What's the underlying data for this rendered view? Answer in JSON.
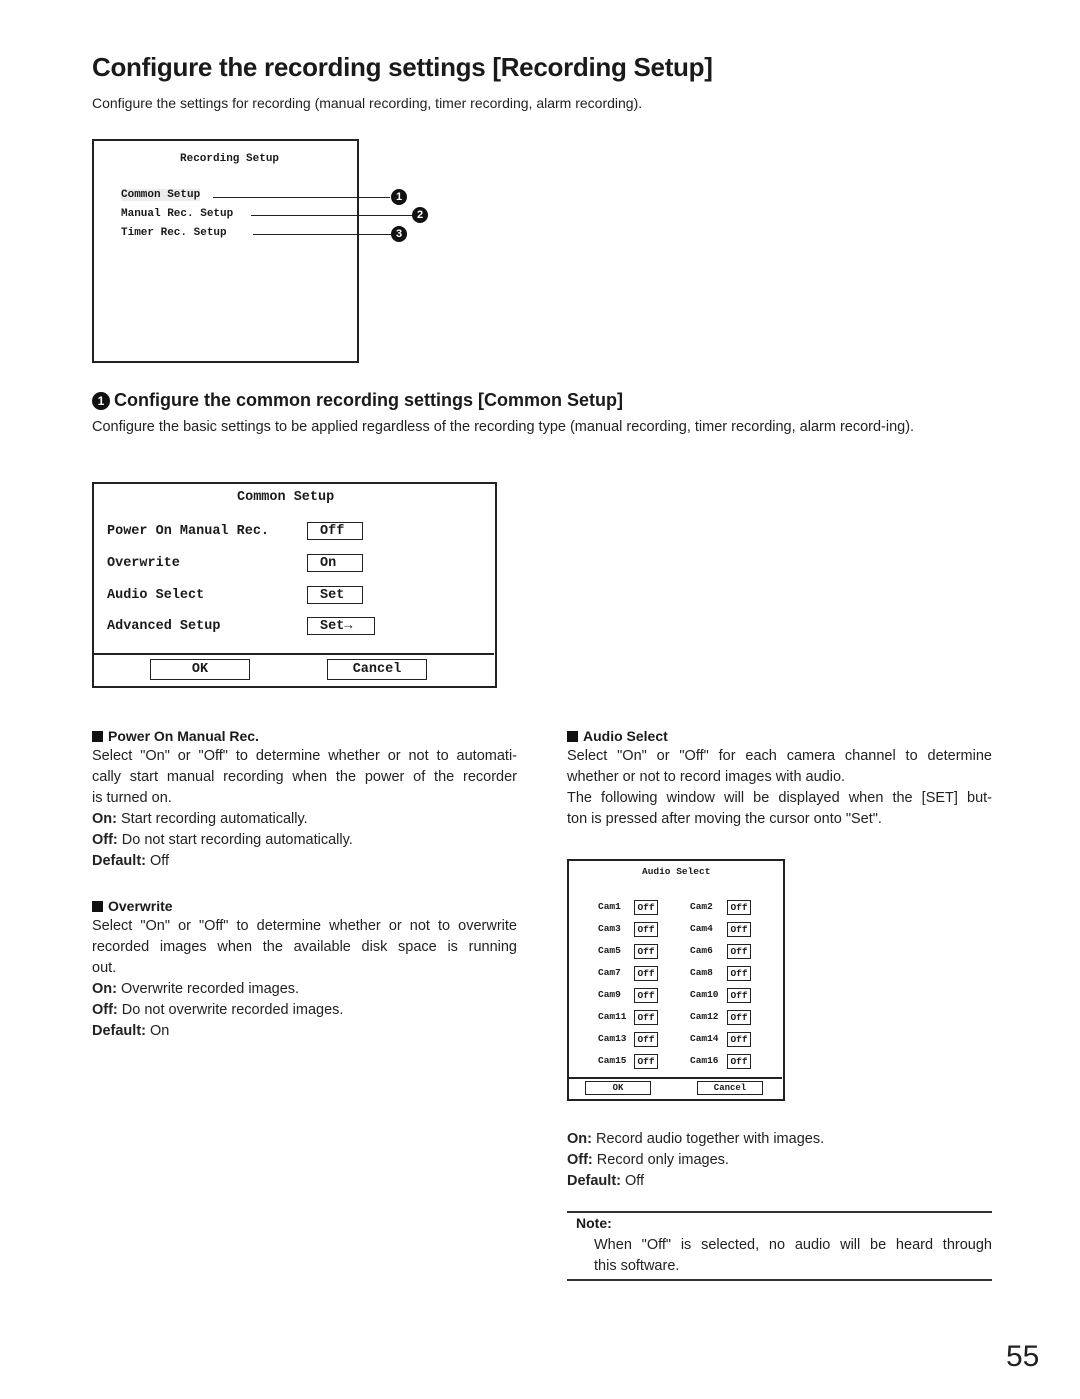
{
  "page": {
    "title": "Configure the recording settings [Recording Setup]",
    "intro": "Configure the settings for recording (manual recording, timer recording, alarm recording).",
    "page_number": "55"
  },
  "recording_setup_screen": {
    "title": "Recording Setup",
    "items": [
      {
        "label": "Common Setup",
        "callout": "1",
        "selected": true
      },
      {
        "label": "Manual Rec. Setup",
        "callout": "2",
        "selected": false
      },
      {
        "label": "Timer Rec. Setup",
        "callout": "3",
        "selected": false
      }
    ]
  },
  "common_section": {
    "callout": "1",
    "heading": "Configure the common recording settings [Common Setup]",
    "description": "Configure the basic settings to be applied regardless of the recording type (manual recording, timer recording, alarm record-ing)."
  },
  "common_setup_screen": {
    "title": "Common Setup",
    "rows": [
      {
        "label": "Power On Manual Rec.",
        "value": "Off"
      },
      {
        "label": "Overwrite",
        "value": "On"
      },
      {
        "label": "Audio Select",
        "value": "Set"
      },
      {
        "label": "Advanced Setup",
        "value": "Set→"
      }
    ],
    "ok_label": "OK",
    "cancel_label": "Cancel"
  },
  "power_on_section": {
    "heading": "Power On Manual Rec.",
    "lines": [
      "Select \"On\" or \"Off\" to determine whether or not to automati-",
      "cally start manual recording when the power of the recorder",
      "is turned on."
    ],
    "on_label": "On:",
    "on_text": " Start recording automatically.",
    "off_label": "Off:",
    "off_text": " Do not start recording automatically.",
    "default_label": "Default:",
    "default_value": " Off"
  },
  "overwrite_section": {
    "heading": "Overwrite",
    "lines": [
      "Select \"On\" or \"Off\" to determine whether or not to overwrite",
      "recorded images when the available disk space is running",
      "out."
    ],
    "on_label": "On:",
    "on_text": " Overwrite recorded images.",
    "off_label": "Off:",
    "off_text": " Do not overwrite recorded images.",
    "default_label": "Default:",
    "default_value": " On"
  },
  "audio_section": {
    "heading": "Audio Select",
    "lines": [
      "Select \"On\" or \"Off\" for each camera channel to determine",
      "whether or not to record images with audio.",
      "The following window will be displayed when the [SET] but-",
      "ton is pressed after moving the cursor onto \"Set\"."
    ],
    "on_label": "On:",
    "on_text": " Record audio together with images.",
    "off_label": "Off:",
    "off_text": " Record only images.",
    "default_label": "Default:",
    "default_value": " Off"
  },
  "audio_select_screen": {
    "title": "Audio Select",
    "cameras": [
      {
        "name": "Cam1",
        "value": "Off"
      },
      {
        "name": "Cam2",
        "value": "Off"
      },
      {
        "name": "Cam3",
        "value": "Off"
      },
      {
        "name": "Cam4",
        "value": "Off"
      },
      {
        "name": "Cam5",
        "value": "Off"
      },
      {
        "name": "Cam6",
        "value": "Off"
      },
      {
        "name": "Cam7",
        "value": "Off"
      },
      {
        "name": "Cam8",
        "value": "Off"
      },
      {
        "name": "Cam9",
        "value": "Off"
      },
      {
        "name": "Cam10",
        "value": "Off"
      },
      {
        "name": "Cam11",
        "value": "Off"
      },
      {
        "name": "Cam12",
        "value": "Off"
      },
      {
        "name": "Cam13",
        "value": "Off"
      },
      {
        "name": "Cam14",
        "value": "Off"
      },
      {
        "name": "Cam15",
        "value": "Off"
      },
      {
        "name": "Cam16",
        "value": "Off"
      }
    ],
    "ok_label": "OK",
    "cancel_label": "Cancel"
  },
  "note": {
    "label": "Note:",
    "lines": [
      "When \"Off\" is selected, no audio will be heard through",
      "this software."
    ]
  }
}
